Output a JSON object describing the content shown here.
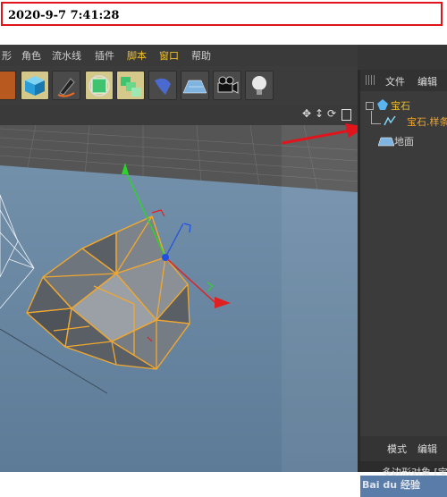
{
  "timestamp": "2020-9-7 7:41:28",
  "menu": {
    "items": [
      "形",
      "角色",
      "流水线",
      "插件",
      "脚本",
      "窗口",
      "帮助"
    ]
  },
  "toolbar": {
    "tools": [
      "gear-tool",
      "cube-tool",
      "pen-tool",
      "subdivision-tool",
      "array-tool",
      "deformer-tool",
      "floor-tool",
      "camera-tool",
      "light-tool"
    ]
  },
  "object_manager": {
    "tab_file": "文件",
    "tab_edit": "编辑",
    "objects": [
      {
        "label": "宝石",
        "color": "#f0c02a"
      },
      {
        "label": "宝石.样条",
        "color": "#f0a830"
      },
      {
        "label": "地面",
        "color": "#d0d0d0"
      }
    ]
  },
  "attributes": {
    "tab_mode": "模式",
    "tab_edit": "编辑",
    "object_label": "多边形对象 [宝"
  },
  "watermark": "Bai du 经验",
  "colors": {
    "timestamp_border": "#e0141a",
    "selection": "#f0a830",
    "viewport_sky": "#4a4a4a",
    "viewport_floor": "#6b8aa6",
    "arrow": "#e0141a"
  }
}
